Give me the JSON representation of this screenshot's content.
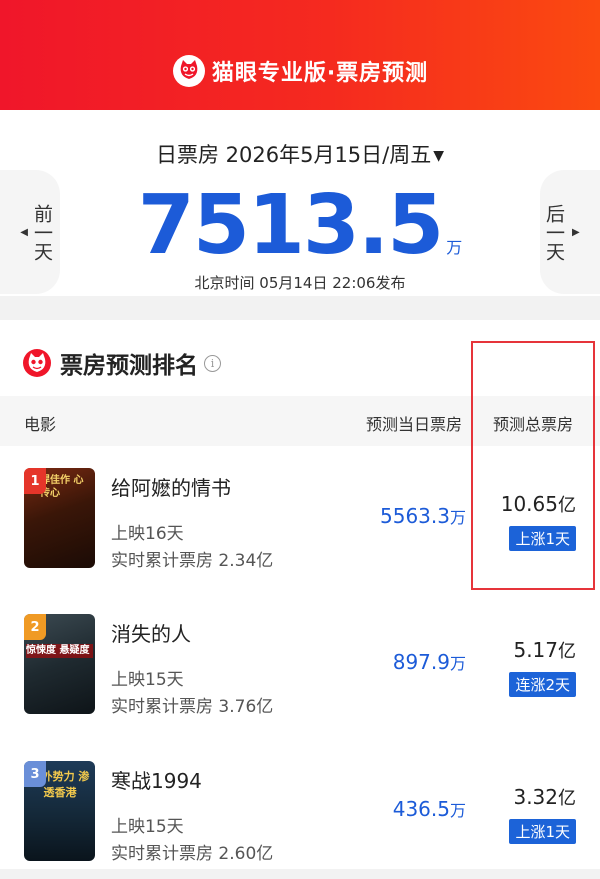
{
  "header": {
    "brand": "猫眼专业版·票房预测",
    "accent": "#f0162a"
  },
  "summary": {
    "date_label": "日票房 2026年5月15日/周五",
    "prev_label": "前一天",
    "next_label": "后一天",
    "total_value": "7513.5",
    "total_unit": "万",
    "publish_text": "北京时间 05月14日 22:06发布",
    "value_color": "#1c5bd8"
  },
  "ranking": {
    "title": "票房预测排名",
    "columns": {
      "movie": "电影",
      "day_box": "预测当日票房",
      "total_box": "预测总票房"
    },
    "rows": [
      {
        "rank": "1",
        "name": "给阿嬷的情书",
        "days": "上映16天",
        "cumulative": "实时累计票房 2.34亿",
        "day_value": "5563.3",
        "day_unit": "万",
        "total_value": "10.65",
        "total_unit": "亿",
        "tag": "上涨1天",
        "poster_text": "悍佳作 心传心"
      },
      {
        "rank": "2",
        "name": "消失的人",
        "days": "上映15天",
        "cumulative": "实时累计票房 3.76亿",
        "day_value": "897.9",
        "day_unit": "万",
        "total_value": "5.17",
        "total_unit": "亿",
        "tag": "连涨2天",
        "poster_text": "惊悚度 悬疑度"
      },
      {
        "rank": "3",
        "name": "寒战1994",
        "days": "上映15天",
        "cumulative": "实时累计票房 2.60亿",
        "day_value": "436.5",
        "day_unit": "万",
        "total_value": "3.32",
        "total_unit": "亿",
        "tag": "上涨1天",
        "poster_text": "境外势力 渗透香港"
      }
    ]
  }
}
